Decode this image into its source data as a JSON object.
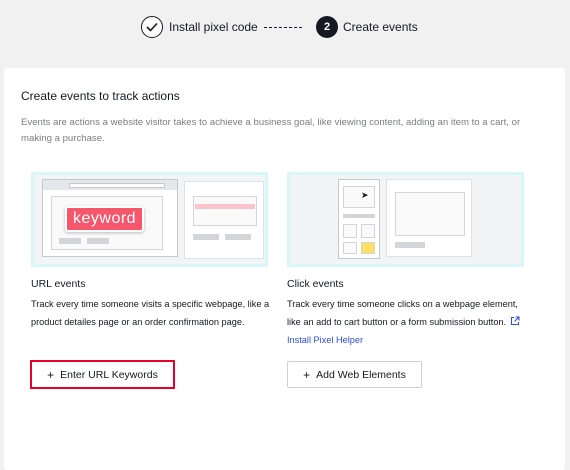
{
  "stepper": {
    "step1_label": "Install pixel code",
    "step2_number": "2",
    "step2_label": "Create events"
  },
  "card": {
    "title": "Create events to track actions",
    "description": "Events are actions a website visitor takes to achieve a business goal, like viewing content, adding an item to a cart, or making a purchase."
  },
  "url_events": {
    "keyword_badge": "keyword",
    "title": "URL events",
    "description": "Track every time someone visits a specific webpage, like a product detailes page or an order confirmation page.",
    "button_label": "Enter URL Keywords"
  },
  "click_events": {
    "title": "Click events",
    "description": "Track every time someone clicks on a webpage element, like an add to cart button or a form submission button.",
    "link_label": "Install Pixel Helper",
    "button_label": "Add Web Elements"
  },
  "icons": {
    "step1": "check-icon",
    "button_plus": "plus-icon",
    "external": "external-link-icon",
    "cursor": "cursor-icon"
  },
  "colors": {
    "accent_link": "#2d4ed8",
    "highlight": "#e4002b",
    "keyword": "#f5566b",
    "illustration_border": "#d9f6fb"
  }
}
